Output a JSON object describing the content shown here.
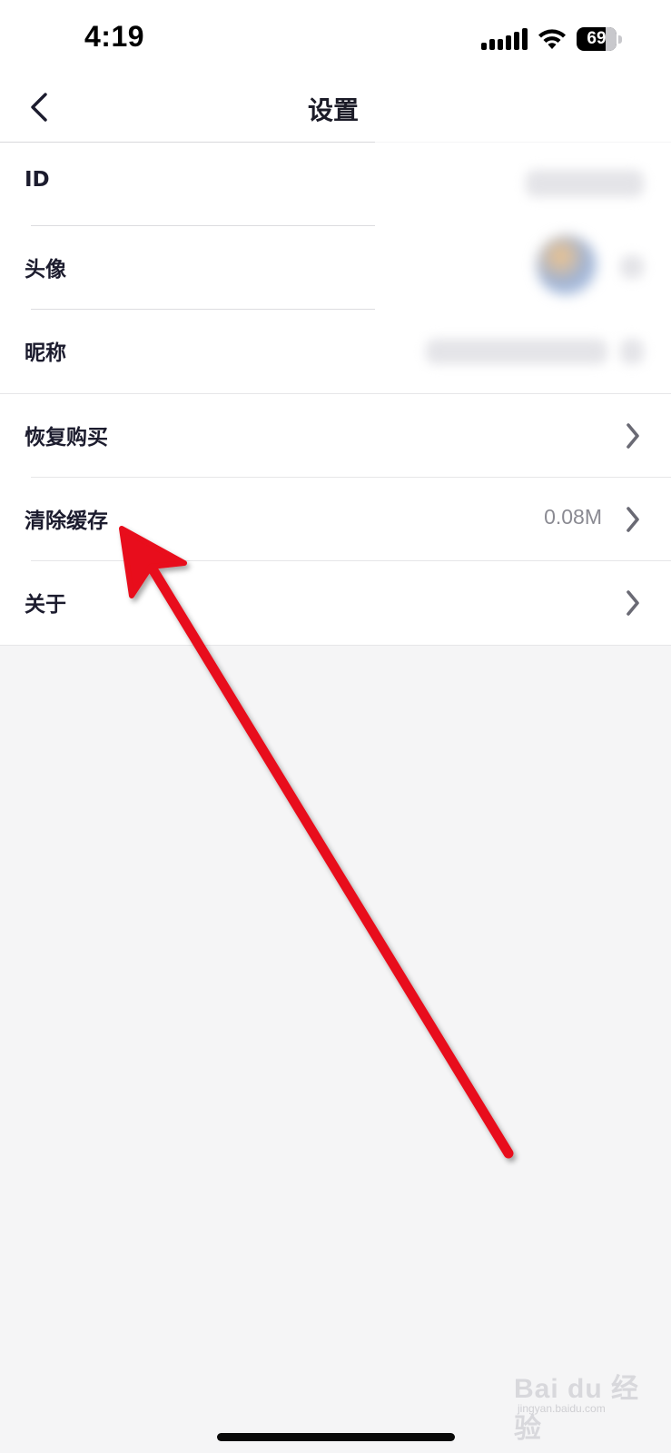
{
  "status_bar": {
    "time": "4:19",
    "battery_level": "69",
    "icons": [
      "signal-icon",
      "wifi-icon",
      "battery-icon"
    ]
  },
  "nav": {
    "title": "设置",
    "back_icon": "chevron-left-icon"
  },
  "settings": {
    "items": [
      {
        "label": "ID",
        "value": "",
        "has_chevron": false
      },
      {
        "label": "头像",
        "value": "",
        "has_chevron": false
      },
      {
        "label": "昵称",
        "value": "",
        "has_chevron": false
      },
      {
        "label": "恢复购买",
        "value": "",
        "has_chevron": true
      },
      {
        "label": "清除缓存",
        "value": "0.08M",
        "has_chevron": true
      },
      {
        "label": "关于",
        "value": "",
        "has_chevron": true
      }
    ]
  },
  "annotation": {
    "arrow_color": "#e8101a",
    "icon": "arrow-icon"
  },
  "watermark": {
    "brand": "Bai du 经验",
    "url": "jingyan.baidu.com"
  },
  "colors": {
    "background": "#f5f5f6",
    "surface": "#ffffff",
    "text_primary": "#1c1c2e",
    "text_secondary": "#8a8a92",
    "divider": "#e6e6e8"
  }
}
